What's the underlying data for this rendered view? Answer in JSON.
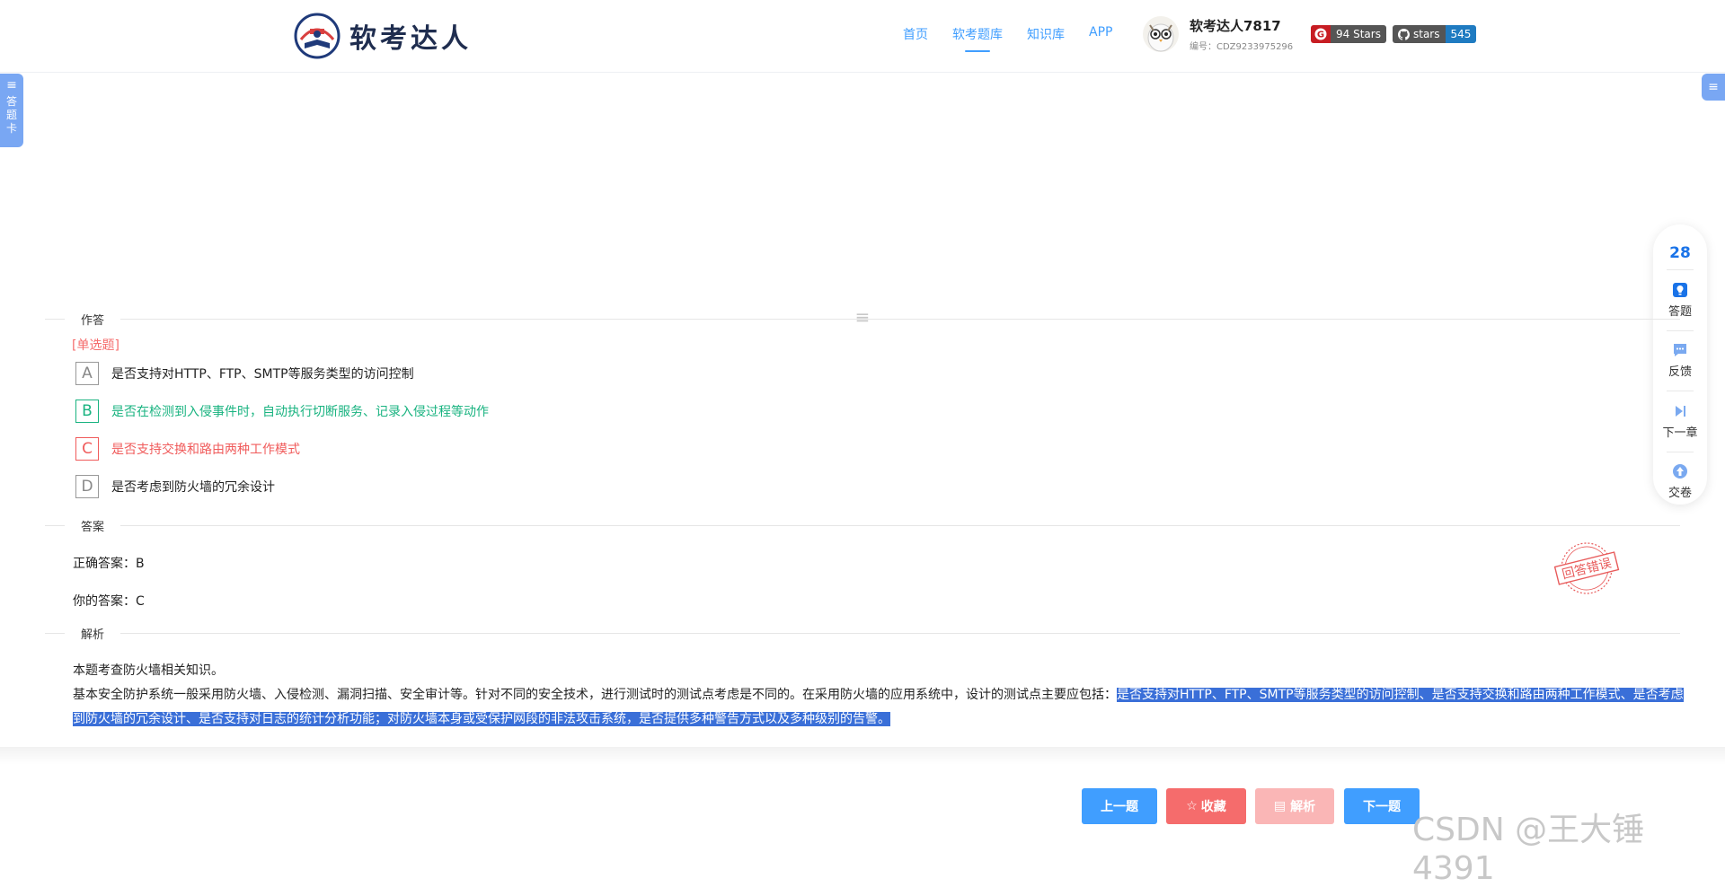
{
  "header": {
    "logo_text": "软考达人",
    "nav": [
      "首页",
      "软考题库",
      "知识库",
      "APP"
    ],
    "active_nav_index": 1,
    "user": {
      "name": "软考达人7817",
      "id": "编号：CDZ9233975296"
    },
    "badges": {
      "gitee": {
        "label": "94 Stars"
      },
      "github": {
        "label": "stars",
        "count": "545"
      }
    }
  },
  "sidebar_left": {
    "text_chars": [
      "答",
      "题",
      "卡"
    ]
  },
  "right_panel": {
    "count": "28",
    "items": [
      {
        "label": "答题",
        "icon": "answer-icon"
      },
      {
        "label": "反馈",
        "icon": "feedback-icon"
      },
      {
        "label": "下一章",
        "icon": "next-chapter-icon"
      },
      {
        "label": "交卷",
        "icon": "submit-icon"
      }
    ]
  },
  "sections": {
    "answer_area": "作答",
    "answer": "答案",
    "analysis": "解析"
  },
  "question": {
    "type": "[单选题]",
    "options": [
      {
        "letter": "A",
        "text": "是否支持对HTTP、FTP、SMTP等服务类型的访问控制"
      },
      {
        "letter": "B",
        "text": "是否在检测到入侵事件时，自动执行切断服务、记录入侵过程等动作"
      },
      {
        "letter": "C",
        "text": "是否支持交换和路由两种工作模式"
      },
      {
        "letter": "D",
        "text": "是否考虑到防火墙的冗余设计"
      }
    ]
  },
  "answer": {
    "correct_label": "正确答案：",
    "correct": "B",
    "yours_label": "你的答案：",
    "yours": "C",
    "stamp_text": "回答错误"
  },
  "analysis": {
    "line1": "本题考查防火墙相关知识。",
    "line2_plain": "基本安全防护系统一般采用防火墙、入侵检测、漏洞扫描、安全审计等。针对不同的安全技术，进行测试时的测试点考虑是不同的。在采用防火墙的应用系统中，设计的测试点主要应包括：",
    "line2_highlight": "是否支持对HTTP、FTP、SMTP等服务类型的访问控制、是否支持交换和路由两种工作模式、是否考虑到防火墙的冗余设计、是否支持对日志的统计分析功能；对防火墙本身或受保护网段的非法攻击系统，是否提供多种警告方式以及多种级别的告警。"
  },
  "footer": {
    "prev": "上一题",
    "favorite": "收藏",
    "analysis": "解析",
    "next": "下一题"
  },
  "watermark": "CSDN @王大锤4391",
  "colors": {
    "primary": "#409eff",
    "danger": "#f56c6c",
    "success": "#19b380",
    "highlight": "#3a6fd8"
  }
}
